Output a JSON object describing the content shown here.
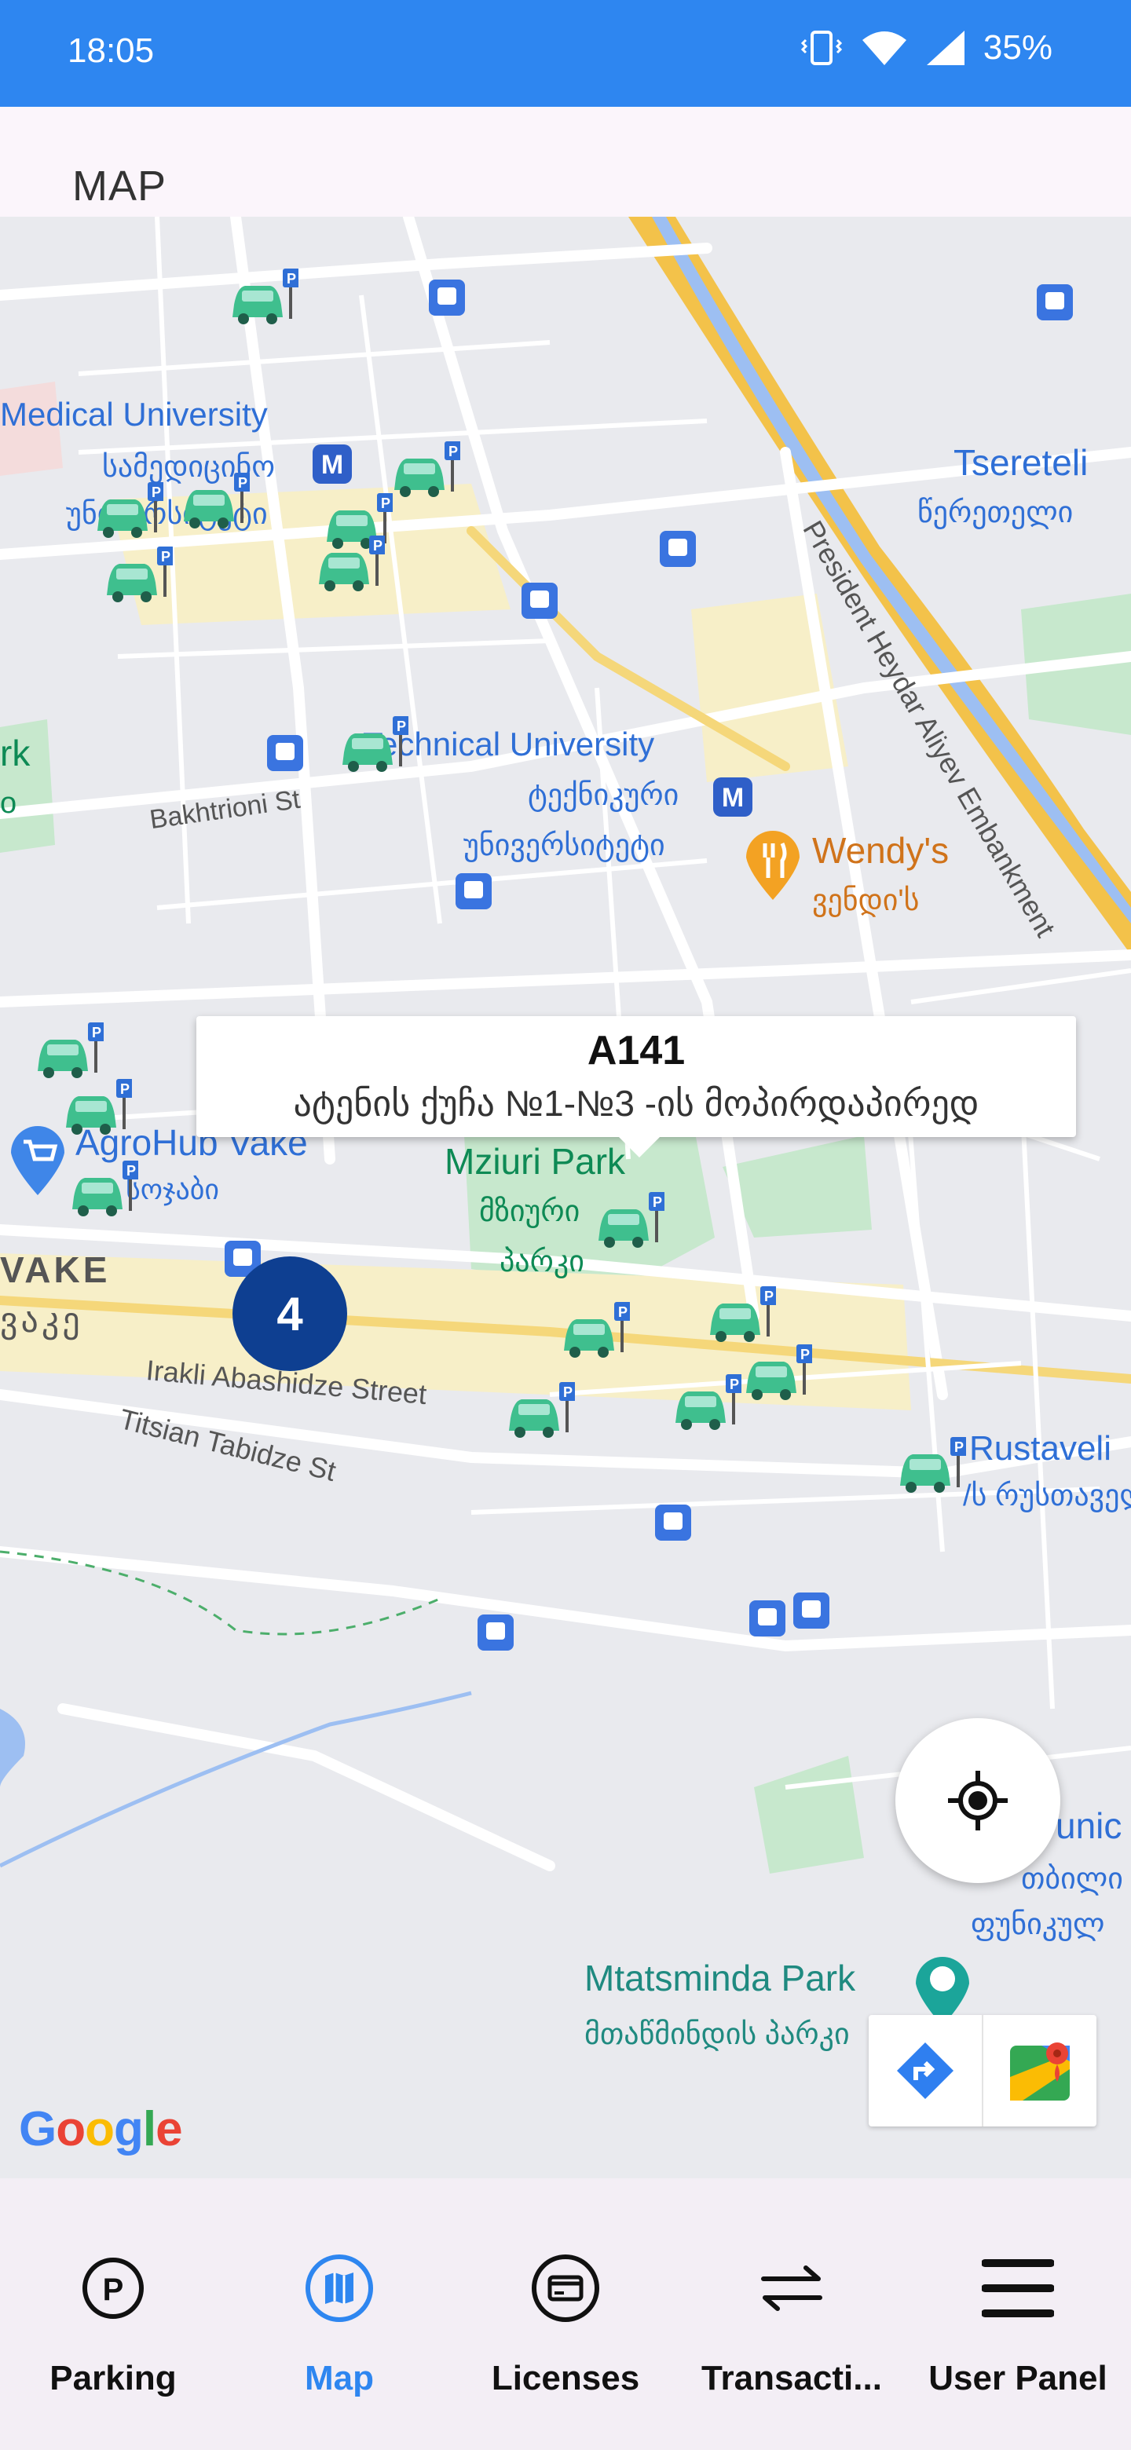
{
  "status_bar": {
    "time": "18:05",
    "battery": "35%"
  },
  "header": {
    "title": "MAP"
  },
  "map": {
    "labels": {
      "medical_university": "Medical University",
      "medical_university_ka": "სამედიცინო",
      "medical_university_ka2": "უნივერსიტეტი",
      "technical_university": "Technical University",
      "technical_university_ka": "ტექნიკური",
      "technical_university_ka2": "უნივერსიტეტი",
      "bakhtrioni": "Bakhtrioni St",
      "wendys": "Wendy's",
      "wendys_ka": "ვენდი'ს",
      "tsereteli": "Tsereteli",
      "tsereteli_ka": "წერეთელი",
      "embankment": "President Heydar Aliyev Embankment",
      "agrohub": "AgroHub Vake",
      "agrohub_ka": "სოჯაბი",
      "mziuri": "Mziuri Park",
      "mziuri_ka": "მზიური",
      "mziuri_ka2": "პარკი",
      "vake": "VAKE",
      "vake_ka": "ვაკე",
      "abashidze": "Irakli Abashidze Street",
      "tabidze": "Titsian Tabidze St",
      "rustaveli": "Rustaveli",
      "rustaveli_ka": "/ს რუსთაველი",
      "mtatsminda": "Mtatsminda Park",
      "mtatsminda_ka": "მთაწმინდის პარკი",
      "funicular": "unic",
      "funicular_ka": "თბილი",
      "funicular_ka2": "ფუნიკულ",
      "rk": "rk",
      "rk2": "o",
      "google": "Google"
    },
    "callout": {
      "code": "A141",
      "address": "ატენის ქუჩა №1-№3 -ის მოპირდაპირედ"
    },
    "cluster": {
      "count": "4"
    }
  },
  "nav": {
    "items": [
      {
        "label": "Parking",
        "icon": "parking-icon",
        "active": false
      },
      {
        "label": "Map",
        "icon": "map-icon",
        "active": true
      },
      {
        "label": "Licenses",
        "icon": "license-card-icon",
        "active": false
      },
      {
        "label": "Transacti...",
        "icon": "transactions-icon",
        "active": false
      },
      {
        "label": "User Panel",
        "icon": "menu-icon",
        "active": false
      }
    ]
  },
  "colors": {
    "accent": "#2e86f0",
    "cluster": "#0e3f91",
    "marker": "#3fbf8e"
  }
}
